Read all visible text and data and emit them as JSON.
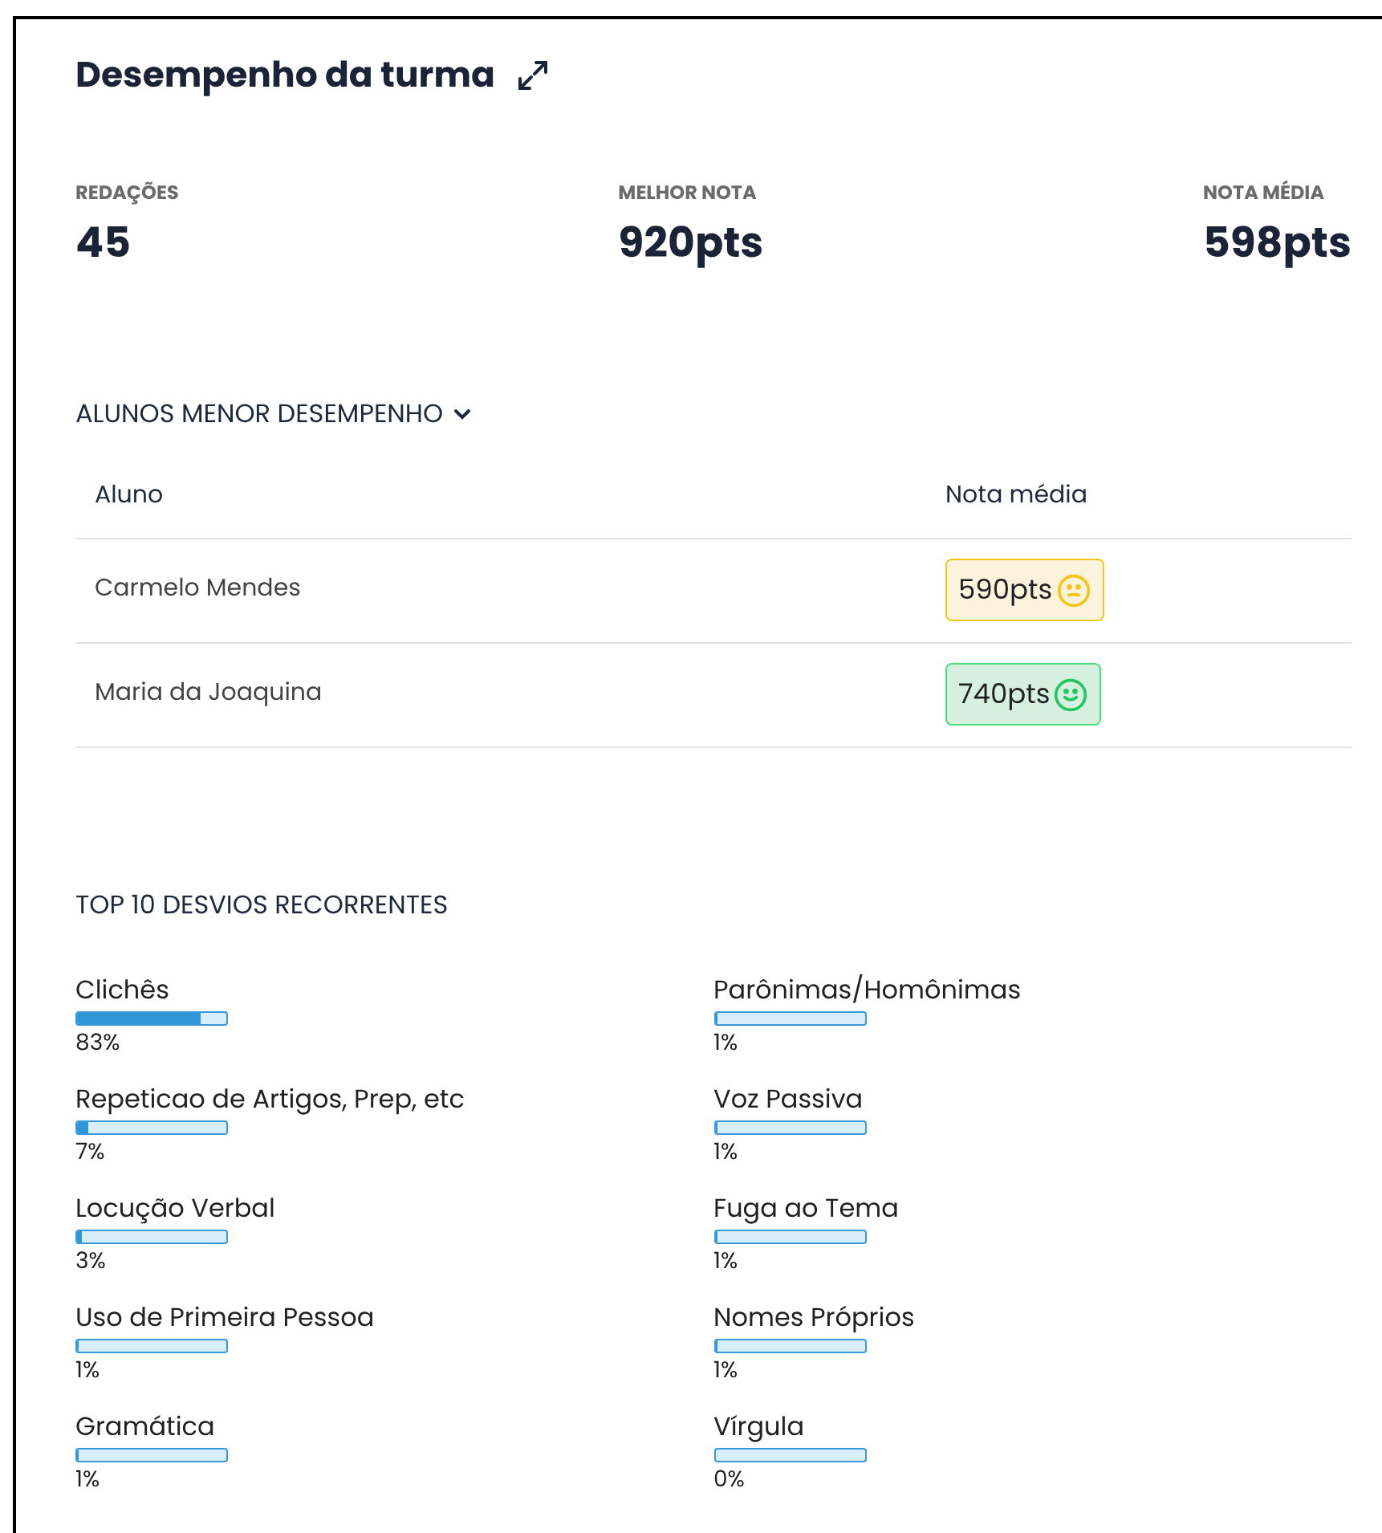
{
  "title": "Desempenho da turma",
  "stats": [
    {
      "label": "REDAÇÕES",
      "value": "45"
    },
    {
      "label": "MELHOR NOTA",
      "value": "920pts"
    },
    {
      "label": "NOTA MÉDIA",
      "value": "598pts"
    }
  ],
  "low_students": {
    "heading": "ALUNOS MENOR DESEMPENHO",
    "expanded": true,
    "columns": [
      "Aluno",
      "Nota média"
    ],
    "rows": [
      {
        "name": "Carmelo Mendes",
        "grade": "590pts",
        "kind": "neutral"
      },
      {
        "name": "Maria da Joaquina",
        "grade": "740pts",
        "kind": "happy"
      }
    ]
  },
  "deviations": {
    "heading": "TOP 10 DESVIOS RECORRENTES",
    "columns": [
      [
        {
          "label": "Clichês",
          "level": 0.83,
          "reading": "83%"
        },
        {
          "label": "Repeticao de Artigos, Prep, etc",
          "level": 0.07,
          "reading": "7%"
        },
        {
          "label": "Locução Verbal",
          "level": 0.03,
          "reading": "3%"
        },
        {
          "label": "Uso de Primeira Pessoa",
          "level": 0.01,
          "reading": "1%"
        },
        {
          "label": "Gramática",
          "level": 0.01,
          "reading": "1%"
        }
      ],
      [
        {
          "label": "Parônimas/Homônimas",
          "level": 0.01,
          "reading": "1%"
        },
        {
          "label": "Voz Passiva",
          "level": 0.01,
          "reading": "1%"
        },
        {
          "label": "Fuga ao Tema",
          "level": 0.01,
          "reading": "1%"
        },
        {
          "label": "Nomes Próprios",
          "level": 0.01,
          "reading": "1%"
        },
        {
          "label": "Vírgula",
          "level": 0,
          "reading": "0%"
        }
      ]
    ]
  }
}
